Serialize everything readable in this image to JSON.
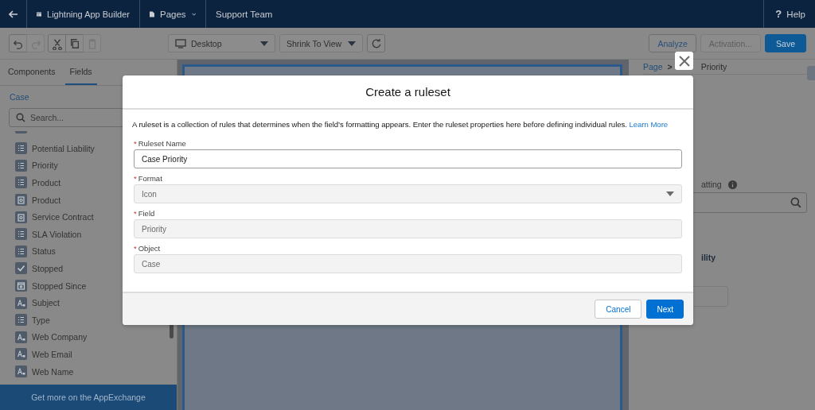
{
  "top_bar": {
    "app_name": "Lightning App Builder",
    "pages_menu": "Pages",
    "page_name": "Support Team",
    "help_icon": "?",
    "help": "Help"
  },
  "toolbar": {
    "edit_buttons": [
      {
        "kind": "undo",
        "disabled": false
      },
      {
        "kind": "redo",
        "disabled": true
      },
      {
        "kind": "cut",
        "disabled": false
      },
      {
        "kind": "copy",
        "disabled": false
      },
      {
        "kind": "paste",
        "disabled": true
      }
    ],
    "device": "Desktop",
    "zoom": "Shrink To View",
    "buttons": [
      {
        "label": "Analyze",
        "kind": "neutral",
        "disabled": false
      },
      {
        "label": "Activation...",
        "kind": "neutral",
        "disabled": true
      },
      {
        "label": "Save",
        "kind": "brand",
        "disabled": false
      }
    ]
  },
  "sidebar": {
    "tabs": [
      {
        "label": "Components",
        "selected": false
      },
      {
        "label": "Fields",
        "selected": true
      }
    ],
    "object": "Case",
    "search": {
      "placeholder": "Search..."
    },
    "fields": [
      {
        "label": "Potential Liability",
        "kind": "picklist"
      },
      {
        "label": "Priority",
        "kind": "picklist"
      },
      {
        "label": "Product",
        "kind": "picklist"
      },
      {
        "label": "Product",
        "kind": "lookup"
      },
      {
        "label": "Service Contract",
        "kind": "lookup"
      },
      {
        "label": "SLA Violation",
        "kind": "picklist"
      },
      {
        "label": "Status",
        "kind": "picklist"
      },
      {
        "label": "Stopped",
        "kind": "checkbox"
      },
      {
        "label": "Stopped Since",
        "kind": "date"
      },
      {
        "label": "Subject",
        "kind": "text"
      },
      {
        "label": "Type",
        "kind": "picklist"
      },
      {
        "label": "Web Company",
        "kind": "text"
      },
      {
        "label": "Web Email",
        "kind": "text"
      },
      {
        "label": "Web Name",
        "kind": "text"
      }
    ],
    "footer": "Get more on the AppExchange"
  },
  "properties_panel": {
    "breadcrumb": [
      "Page",
      ">",
      "Priority"
    ],
    "label_fragment": "atting",
    "heading_fragment": "ility"
  },
  "modal": {
    "title": "Create a ruleset",
    "description": "A ruleset is a collection of rules that determines when the field’s formatting appears. Enter the ruleset properties here before defining individual rules.",
    "learn_more": "Learn More",
    "fields": [
      {
        "label": "Ruleset Name",
        "required_mark": "*",
        "value": "Case Priority",
        "kind": "text",
        "disabled": false
      },
      {
        "label": "Format",
        "required_mark": "*",
        "value": "Icon",
        "kind": "select",
        "disabled": true
      },
      {
        "label": "Field",
        "required_mark": "*",
        "value": "Priority",
        "kind": "text",
        "disabled": true
      },
      {
        "label": "Object",
        "required_mark": "*",
        "value": "Case",
        "kind": "text",
        "disabled": true
      }
    ],
    "buttons": [
      {
        "label": "Cancel",
        "kind": "neutral"
      },
      {
        "label": "Next",
        "kind": "brand"
      }
    ]
  }
}
